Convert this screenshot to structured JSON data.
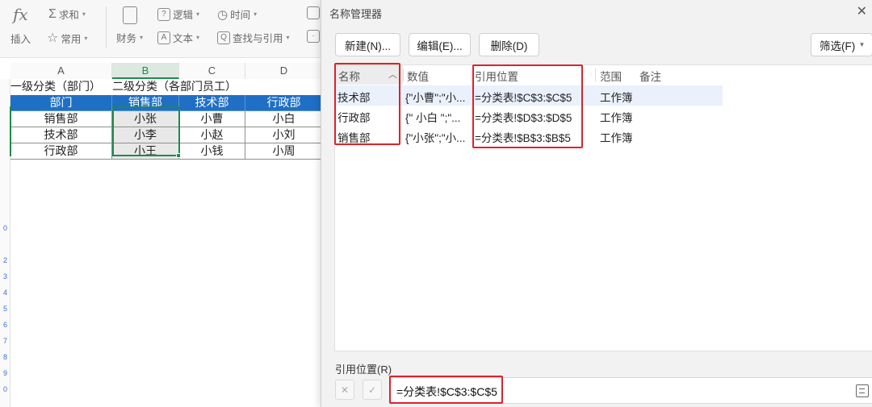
{
  "ribbon": {
    "fx_symbol": "fx",
    "insert_label": "插入",
    "sum_label": "求和",
    "common_label": "常用",
    "finance_label": "财务",
    "logic_label": "逻辑",
    "text_label": "文本",
    "time_label": "时间",
    "lookup_label": "查找与引用"
  },
  "sheet": {
    "columns": [
      "A",
      "B",
      "C",
      "D"
    ],
    "row_numbers": [
      "0",
      "2",
      "3",
      "4",
      "5",
      "6",
      "7",
      "8",
      "9",
      "0"
    ],
    "title_row": [
      "一级分类（部门）",
      "二级分类（各部门员工）"
    ],
    "header_row": [
      "部门",
      "销售部",
      "技术部",
      "行政部"
    ],
    "rows": [
      [
        "销售部",
        "小张",
        "小曹",
        "小白"
      ],
      [
        "技术部",
        "小李",
        "小赵",
        "小刘"
      ],
      [
        "行政部",
        "小王",
        "小钱",
        "小周"
      ]
    ]
  },
  "dialog": {
    "title": "名称管理器",
    "close_glyph": "✕",
    "buttons": {
      "new": "新建(N)...",
      "edit": "编辑(E)...",
      "delete": "删除(D)",
      "filter": "筛选(F)"
    },
    "columns": {
      "name": "名称",
      "value": "数值",
      "refers_to": "引用位置",
      "scope": "范围",
      "comment": "备注"
    },
    "rows": [
      {
        "name": "技术部",
        "value": "{\"小曹\";\"小...",
        "refers_to": "=分类表!$C$3:$C$5",
        "scope": "工作簿"
      },
      {
        "name": "行政部",
        "value": "{\" 小白 \";\"...",
        "refers_to": "=分类表!$D$3:$D$5",
        "scope": "工作簿"
      },
      {
        "name": "销售部",
        "value": "{\"小张\";\"小...",
        "refers_to": "=分类表!$B$3:$B$5",
        "scope": "工作簿"
      }
    ],
    "ref_label": "引用位置(R)",
    "ref_value": "=分类表!$C$3:$C$5",
    "cancel_glyph": "✕",
    "confirm_glyph": "✓"
  },
  "colors": {
    "header_blue": "#1f6fc5",
    "selection_green": "#1f8a4c",
    "highlight_red": "#e0202a",
    "selected_row": "#eaf1fc"
  }
}
